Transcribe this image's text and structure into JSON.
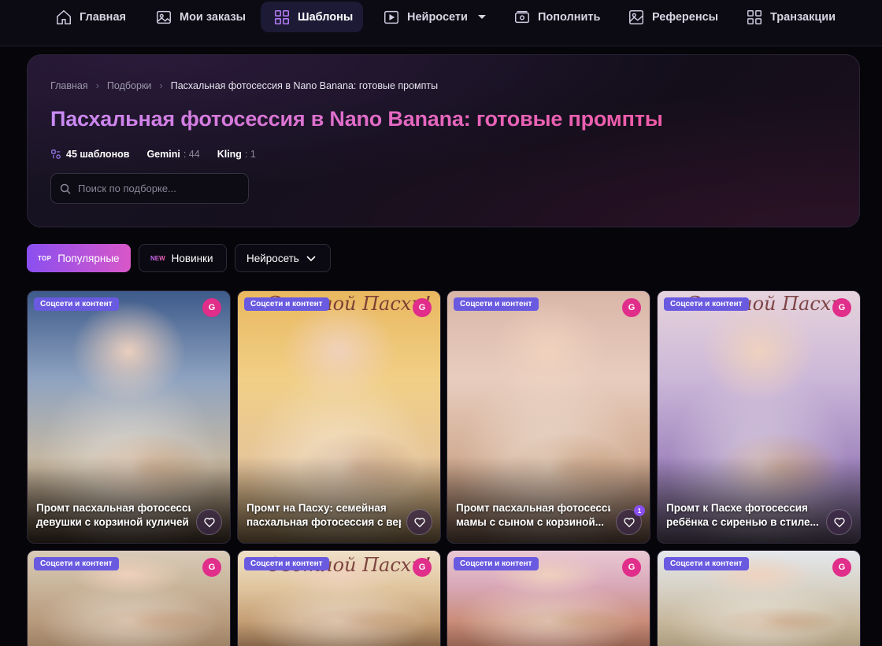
{
  "nav": {
    "items": [
      {
        "label": "Главная",
        "icon": "home-icon"
      },
      {
        "label": "Мои заказы",
        "icon": "gallery-icon"
      },
      {
        "label": "Шаблоны",
        "icon": "templates-icon",
        "active": true
      },
      {
        "label": "Нейросети",
        "icon": "video-icon",
        "dropdown": true
      },
      {
        "label": "Пополнить",
        "icon": "wallet-icon"
      },
      {
        "label": "Референсы",
        "icon": "image-icon"
      },
      {
        "label": "Транзакции",
        "icon": "grid-icon"
      }
    ]
  },
  "breadcrumb": [
    "Главная",
    "Подборки",
    "Пасхальная фотосессия в Nano Banana: готовые промпты"
  ],
  "breadcrumb_sep": "›",
  "title": "Пасхальная фотосессия в Nano Banana: готовые промпты",
  "stats": {
    "templates": "45 шаблонов",
    "gemini_label": "Gemini",
    "gemini_count": ": 44",
    "kling_label": "Kling",
    "kling_count": ": 1"
  },
  "search": {
    "placeholder": "Поиск по подборке..."
  },
  "filters": {
    "popular_tag": "TOP",
    "popular": "Популярные",
    "new_tag": "NEW",
    "new": "Новинки",
    "networks": "Нейросеть"
  },
  "badge_model": "G",
  "cards": [
    {
      "category": "Соцсети и контент",
      "title_1": "Промт пасхальная фотосессия",
      "title_2": "девушки с корзиной куличей и",
      "likes": "",
      "bg": [
        "#3d5a8a",
        "#8fa3c0",
        "#c9b9a0",
        "#5d4a3a"
      ]
    },
    {
      "category": "Соцсети и контент",
      "title_1": "Промт на Пасху: семейная",
      "title_2": "пасхальная фотосессия с верб",
      "likes": "",
      "bg": [
        "#e9b860",
        "#f1cf86",
        "#e5c49a",
        "#b59566"
      ],
      "script": "Светлой Пасхи!"
    },
    {
      "category": "Соцсети и контент",
      "title_1": "Промт пасхальная фотосессия",
      "title_2": "мамы с сыном с корзиной...",
      "likes": "1",
      "bg": [
        "#d9b6a8",
        "#e8cdbf",
        "#cfa98e",
        "#8a6a5a"
      ]
    },
    {
      "category": "Соцсети и контент",
      "title_1": "Промт к Пасхе фотосессия",
      "title_2": "ребёнка с сиренью в стиле...",
      "likes": "",
      "bg": [
        "#e6d3dc",
        "#cbb7d8",
        "#9f84bd",
        "#7a6a8a"
      ],
      "script": "Светлой Пасхи"
    },
    {
      "category": "Соцсети и контент",
      "title_1": "",
      "title_2": "",
      "likes": "",
      "bg": [
        "#d8cbb8",
        "#c9b49a",
        "#b79a7c",
        "#9a7e62"
      ]
    },
    {
      "category": "Соцсети и контент",
      "title_1": "",
      "title_2": "",
      "likes": "",
      "bg": [
        "#efe0c8",
        "#e1c7a1",
        "#c49e74",
        "#7a5a40"
      ],
      "script": "Светлой Пасхи!"
    },
    {
      "category": "Соцсети и контент",
      "title_1": "",
      "title_2": "",
      "likes": "",
      "bg": [
        "#e9c8d3",
        "#d9a8b8",
        "#c98d78",
        "#8a5a4a"
      ]
    },
    {
      "category": "Соцсети и контент",
      "title_1": "",
      "title_2": "",
      "likes": "",
      "bg": [
        "#e4e7ec",
        "#d8d3c8",
        "#c7b89d",
        "#a8987a"
      ]
    }
  ]
}
